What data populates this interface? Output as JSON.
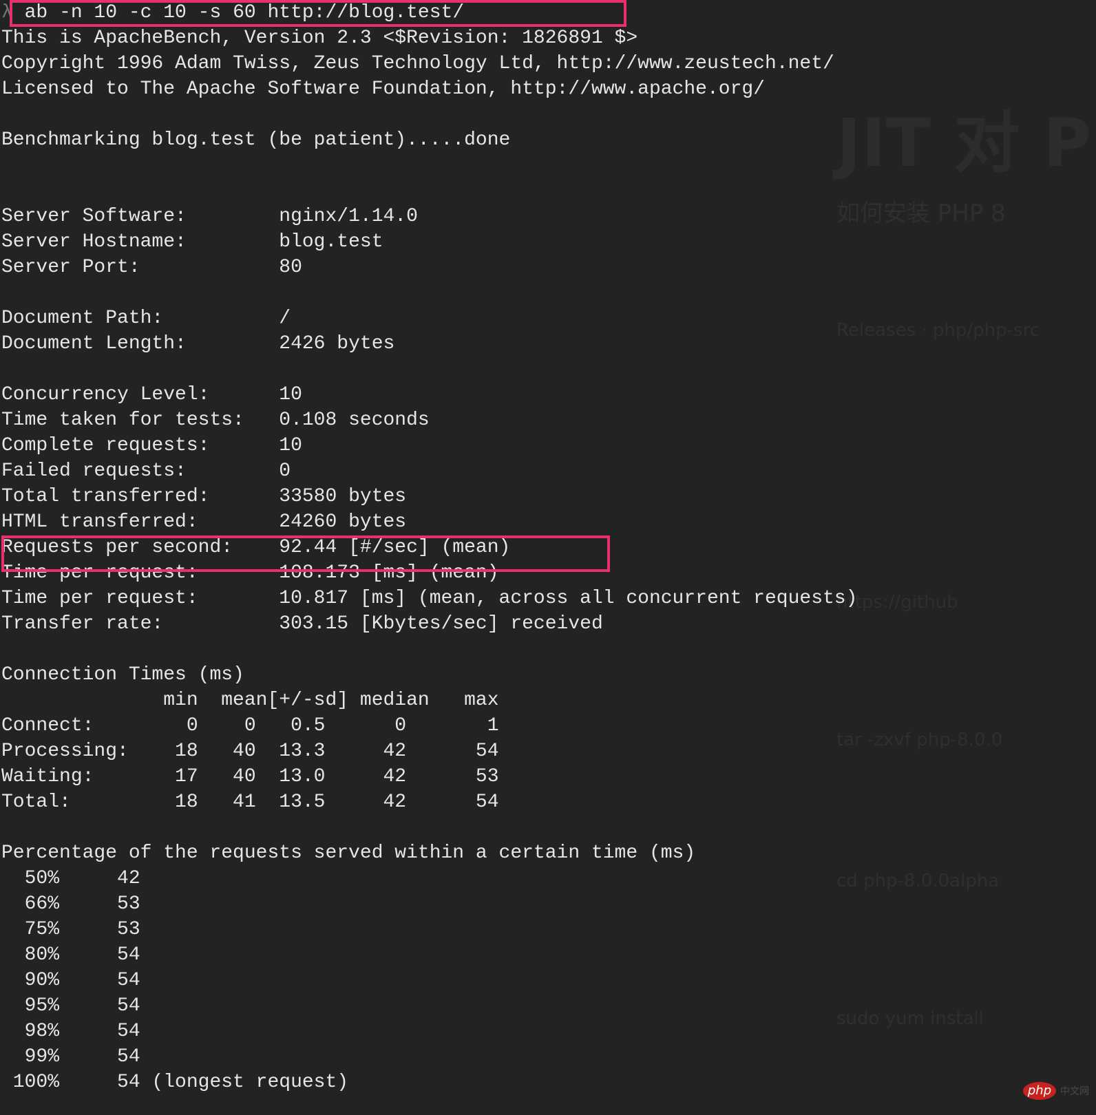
{
  "terminal": {
    "prompt_symbol": "λ",
    "command": " ab -n 10 -c 10 -s 60 http://blog.test/",
    "lines": [
      "This is ApacheBench, Version 2.3 <$Revision: 1826891 $>",
      "Copyright 1996 Adam Twiss, Zeus Technology Ltd, http://www.zeustech.net/",
      "Licensed to The Apache Software Foundation, http://www.apache.org/",
      "Benchmarking blog.test (be patient).....done",
      "Server Software:        nginx/1.14.0",
      "Server Hostname:        blog.test",
      "Server Port:            80",
      "Document Path:          /",
      "Document Length:        2426 bytes",
      "Concurrency Level:      10",
      "Time taken for tests:   0.108 seconds",
      "Complete requests:      10",
      "Failed requests:        0",
      "Total transferred:      33580 bytes",
      "HTML transferred:       24260 bytes",
      "Requests per second:    92.44 [#/sec] (mean)",
      "Time per request:       108.173 [ms] (mean)",
      "Time per request:       10.817 [ms] (mean, across all concurrent requests)",
      "Transfer rate:          303.15 [Kbytes/sec] received",
      "Connection Times (ms)",
      "              min  mean[+/-sd] median   max",
      "Connect:        0    0   0.5      0       1",
      "Processing:    18   40  13.3     42      54",
      "Waiting:       17   40  13.0     42      53",
      "Total:         18   41  13.5     42      54",
      "Percentage of the requests served within a certain time (ms)",
      "  50%     42",
      "  66%     53",
      "  75%     53",
      "  80%     54",
      "  90%     54",
      "  95%     54",
      "  98%     54",
      "  99%     54",
      " 100%     54 (longest request)"
    ]
  },
  "highlight_color": "#e8306a",
  "watermark": {
    "logo": "php",
    "text": "中文网"
  }
}
